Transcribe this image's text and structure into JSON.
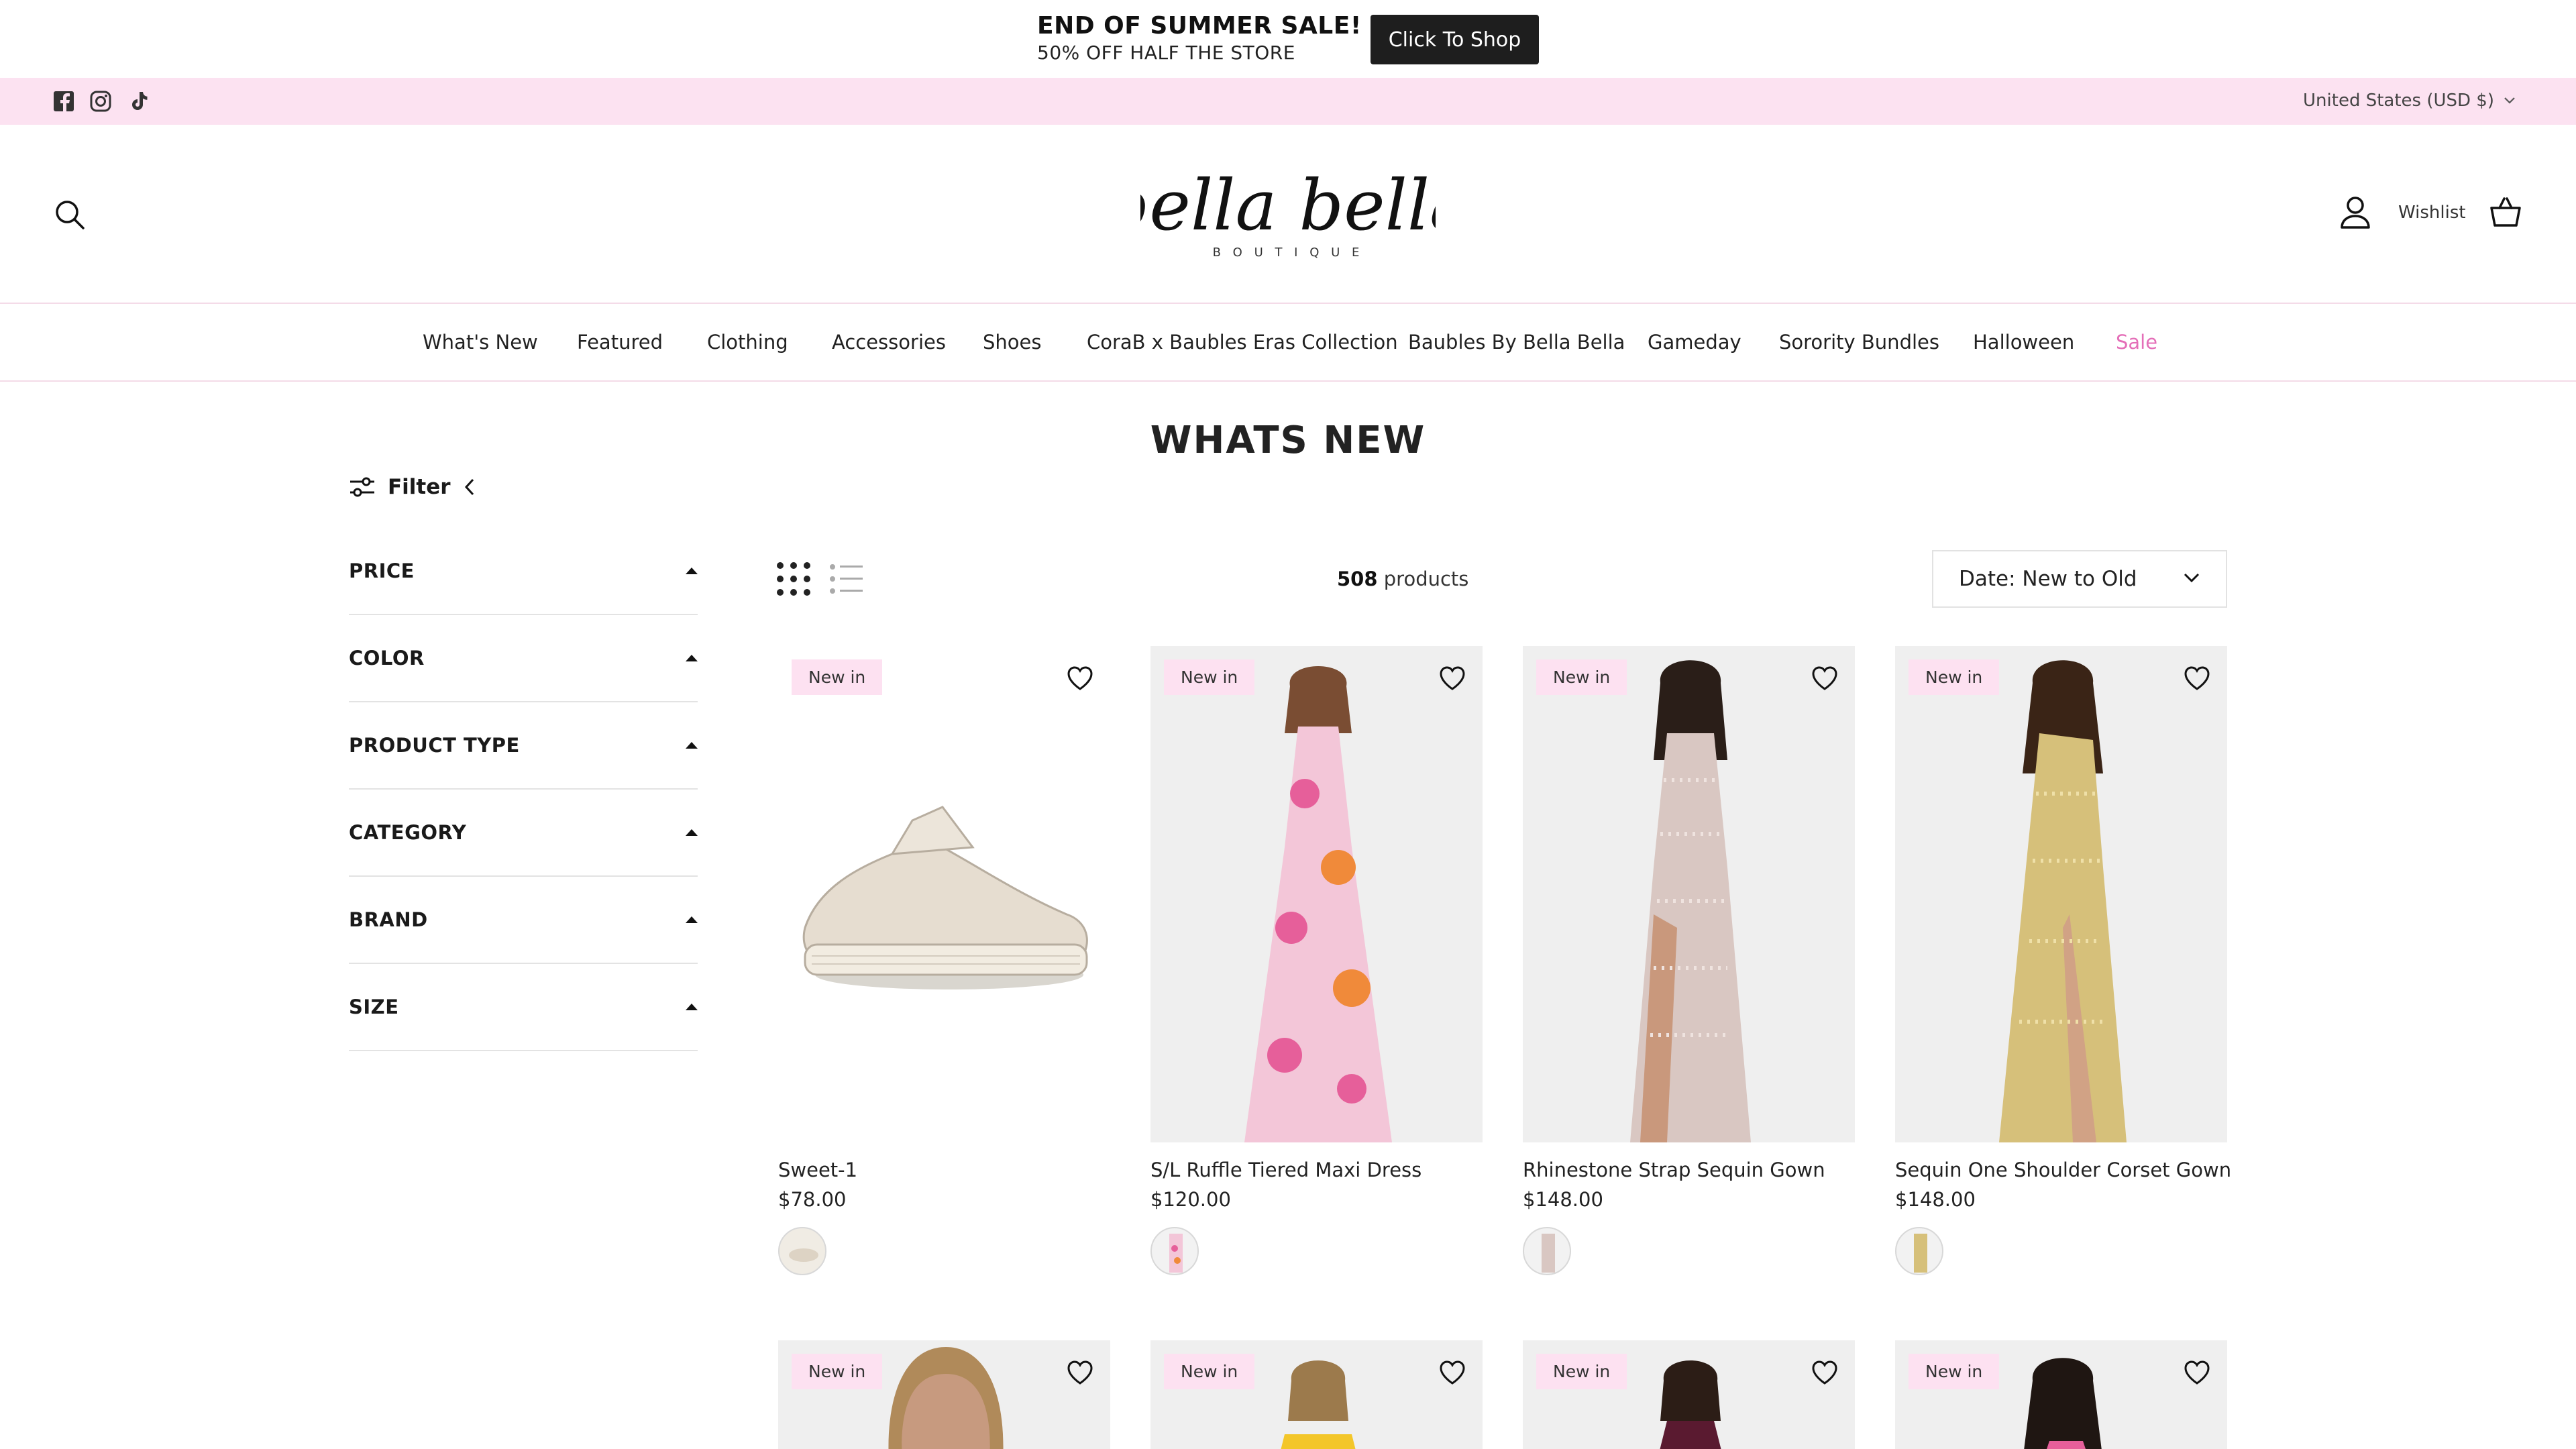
{
  "announcement": {
    "title": "END OF SUMMER SALE!",
    "subtitle": "50% OFF HALF THE STORE",
    "cta": "Click To Shop"
  },
  "utility": {
    "social_icons": [
      "facebook-icon",
      "instagram-icon",
      "tiktok-icon"
    ],
    "currency": "United States (USD $)"
  },
  "header": {
    "logo_script": "bella bella",
    "logo_sub": "B O U T I Q U E",
    "wishlist": "Wishlist"
  },
  "nav": [
    {
      "label": "What's New"
    },
    {
      "label": "Featured"
    },
    {
      "label": "Clothing"
    },
    {
      "label": "Accessories"
    },
    {
      "label": "Shoes"
    },
    {
      "label": "CoraB x Baubles Eras Collection"
    },
    {
      "label": "Baubles By Bella Bella"
    },
    {
      "label": "Gameday"
    },
    {
      "label": "Sorority Bundles"
    },
    {
      "label": "Halloween"
    },
    {
      "label": "Sale"
    }
  ],
  "page_title": "WHATS NEW",
  "filter": {
    "label": "Filter",
    "facets": [
      "PRICE",
      "COLOR",
      "PRODUCT TYPE",
      "CATEGORY",
      "BRAND",
      "SIZE"
    ]
  },
  "toolbar": {
    "count": "508",
    "count_suffix": "products",
    "sort": "Date: New to Old"
  },
  "products": [
    {
      "badge": "New in",
      "name": "Sweet-1",
      "price": "$78.00"
    },
    {
      "badge": "New in",
      "name": "S/L Ruffle Tiered Maxi Dress",
      "price": "$120.00"
    },
    {
      "badge": "New in",
      "name": "Rhinestone Strap Sequin Gown",
      "price": "$148.00"
    },
    {
      "badge": "New in",
      "name": "Sequin One Shoulder Corset Gown",
      "price": "$148.00"
    },
    {
      "badge": "New in"
    },
    {
      "badge": "New in"
    },
    {
      "badge": "New in"
    },
    {
      "badge": "New in"
    }
  ],
  "colors": {
    "announcement_cta_bg": "#1e1e1e",
    "utility_bg": "#fce2f1",
    "badge_bg": "#fde1f1",
    "sale_link": "#e46fb8"
  }
}
